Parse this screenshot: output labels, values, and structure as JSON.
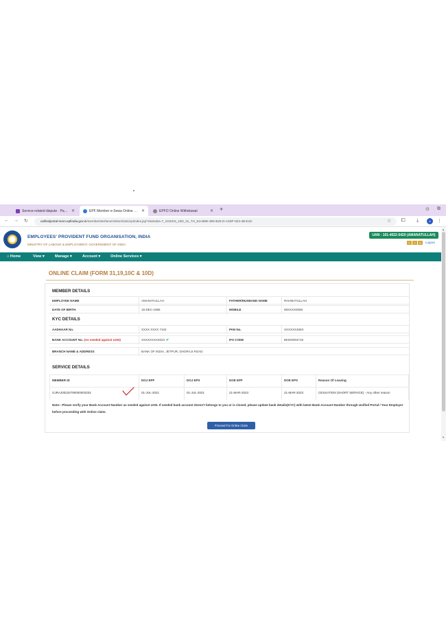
{
  "browser": {
    "tabs": [
      {
        "label": "Service-related dispute · Pay Calc"
      },
      {
        "label": "EPF Member e-Sewa Online Services"
      },
      {
        "label": "EPFO Online Withdrawal"
      }
    ],
    "url_host": "unifiedportal-mem.epfindia.gov.in",
    "url_path": "/memberinterface/online/claim/cp/index.jsp?claimdet=7_1010C5_10D_31_TH_61A98B-49D-B25-D-A3DF-823-4B-E1D"
  },
  "header": {
    "org_name": "EMPLOYEES' PROVIDENT FUND ORGANISATION, INDIA",
    "org_sub": "MINISTRY OF LABOUR & EMPLOYMENT, GOVERNMENT OF INDIA",
    "uan_badge": "UAN : 101-4022-5420 (AMANATULLAH)",
    "mini_buttons": [
      "A-",
      "A",
      "A+"
    ],
    "logout": "Logout"
  },
  "nav": {
    "home": "Home",
    "view": "View ▾",
    "manage": "Manage ▾",
    "account": "Account ▾",
    "online_services": "Online Services ▾"
  },
  "page": {
    "title": "ONLINE CLAIM (FORM 31,19,10C & 10D)",
    "member_details": {
      "heading": "MEMBER DETAILS",
      "employee_name_label": "EMPLOYEE NAME",
      "employee_name": "AMANATULLAH",
      "father_label": "FATHER/HUSBAND NAME",
      "father_name": "RAHMATULLAH",
      "dob_label": "DATE OF BIRTH",
      "dob": "15-DEC-1985",
      "mobile_label": "MOBILE",
      "mobile": "98XXXX0058"
    },
    "kyc_details": {
      "heading": "KYC DETAILS",
      "aadhaar_label": "AADHAAR No.",
      "aadhaar": "XXXX XXXX 7104",
      "pan_label": "PAN No.",
      "pan": "XXXXXX456X",
      "bank_label": "BANK ACCOUNT No.",
      "bank_note": "(As seeded against UAN)",
      "bank_account": "XXXXXXXX4023",
      "ifsc_label": "IFS CODE",
      "ifsc": "BKID0004718",
      "branch_label": "BRANCH NAME & ADDRESS",
      "branch": "BANK OF INDIA, JETPUR, DHORAJI ROAD"
    },
    "service_details": {
      "heading": "SERVICE DETAILS",
      "headers": [
        "MEMBER ID",
        "DOJ EPF",
        "DOJ EPS",
        "DOE EPF",
        "DOE EPS",
        "Reason Of Leaving"
      ],
      "row": [
        "GJRAJ00234790000003334",
        "01-JUL-2021",
        "01-JUL-2021",
        "21-MAR-2023",
        "21-MAR-2023",
        "CESSATION (SHORT SERVICE) - Any other reason"
      ]
    },
    "note": "Note:- Please verify your Bank Account Number as seeded against UAN. If seeded bank account doesn't belongs to you or is closed, please update bank details(KYC) with latest Bank Account Number through Unified Portal / Your Employer before proceeding with Online claim.",
    "proceed_button": "Proceed For Online Claim"
  }
}
